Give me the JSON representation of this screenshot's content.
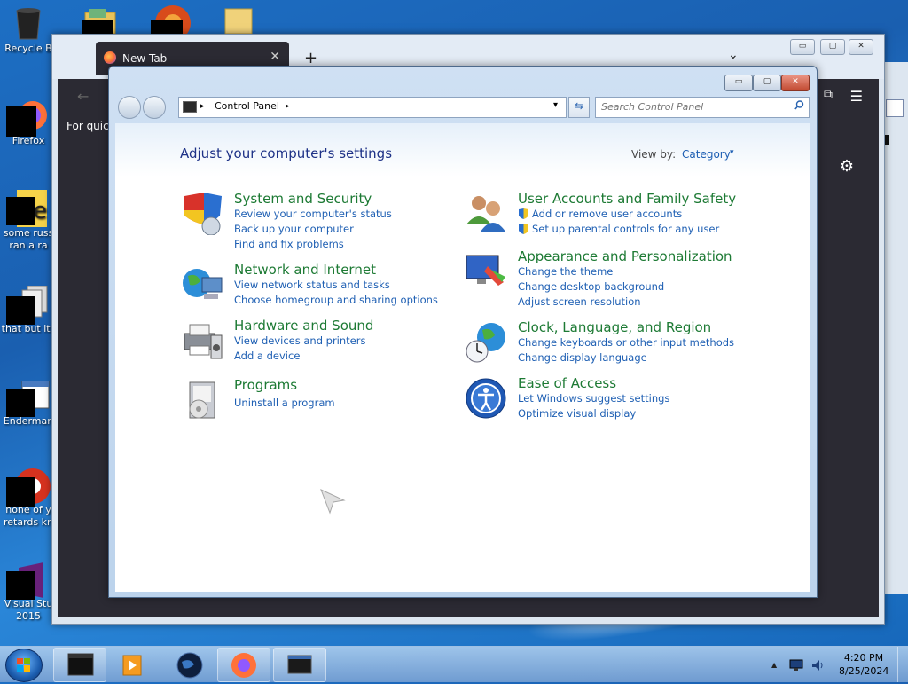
{
  "desktop": {
    "icons": [
      {
        "label": "Recycle B",
        "icon": "recycle-bin-icon"
      },
      {
        "label": "Firefox",
        "icon": "firefox-icon"
      },
      {
        "label": "some russ",
        "label2": "ran a ra",
        "icon": "text-file-icon"
      },
      {
        "label": "that but its",
        "icon": "window-stack-icon"
      },
      {
        "label": "Enderman",
        "icon": "window-icon"
      },
      {
        "label": "none of y",
        "label2": "retards kn",
        "icon": "chrome-icon"
      },
      {
        "label": "Visual Stu",
        "label2": "2015",
        "icon": "visual-studio-icon"
      }
    ]
  },
  "firefox": {
    "tab_title": "New Tab",
    "tab_close": "✕",
    "new_tab": "+",
    "list_tabs": "⌄",
    "quick_text": "For quick",
    "back": "←",
    "menu": "☰",
    "extensions": "⧉",
    "settings": "⚙",
    "window_controls": {
      "minimize": "▭",
      "maximize": "▢",
      "close": "✕"
    }
  },
  "control_panel": {
    "window_controls": {
      "minimize": "▭",
      "maximize": "▢",
      "close": "✕"
    },
    "address": {
      "root_arrow": "▸",
      "segment": "Control Panel",
      "segment_arrow": "▸",
      "dropdown": "▾"
    },
    "refresh": "⇆",
    "search": {
      "placeholder": "Search Control Panel",
      "icon": "🔍"
    },
    "heading": "Adjust your computer's settings",
    "view_by_label": "View by:",
    "view_by_value": "Category",
    "view_by_arrow": "▾",
    "categories": [
      {
        "title": "System and Security",
        "icon": "shield-icon",
        "links": [
          "Review your computer's status",
          "Back up your computer",
          "Find and fix problems"
        ]
      },
      {
        "title": "Network and Internet",
        "icon": "network-globe-icon",
        "links": [
          "View network status and tasks",
          "Choose homegroup and sharing options"
        ]
      },
      {
        "title": "Hardware and Sound",
        "icon": "printer-icon",
        "links": [
          "View devices and printers",
          "Add a device"
        ]
      },
      {
        "title": "Programs",
        "icon": "programs-icon",
        "links": [
          "Uninstall a program"
        ]
      },
      {
        "title": "User Accounts and Family Safety",
        "icon": "users-icon",
        "links": [
          "Add or remove user accounts",
          "Set up parental controls for any user"
        ]
      },
      {
        "title": "Appearance and Personalization",
        "icon": "display-icon",
        "links": [
          "Change the theme",
          "Change desktop background",
          "Adjust screen resolution"
        ]
      },
      {
        "title": "Clock, Language, and Region",
        "icon": "clock-globe-icon",
        "links": [
          "Change keyboards or other input methods",
          "Change display language"
        ]
      },
      {
        "title": "Ease of Access",
        "icon": "ease-of-access-icon",
        "links": [
          "Let Windows suggest settings",
          "Optimize visual display"
        ]
      }
    ]
  },
  "taskbar": {
    "time": "4:20 PM",
    "date": "8/25/2024",
    "tray_arrow": "▲",
    "apps": [
      "terminal-icon",
      "media-player-icon",
      "globe-app-icon",
      "firefox-icon",
      "control-panel-icon"
    ]
  },
  "colors": {
    "link": "#1e5fb3",
    "category": "#1d7a34",
    "heading": "#1e3287"
  }
}
